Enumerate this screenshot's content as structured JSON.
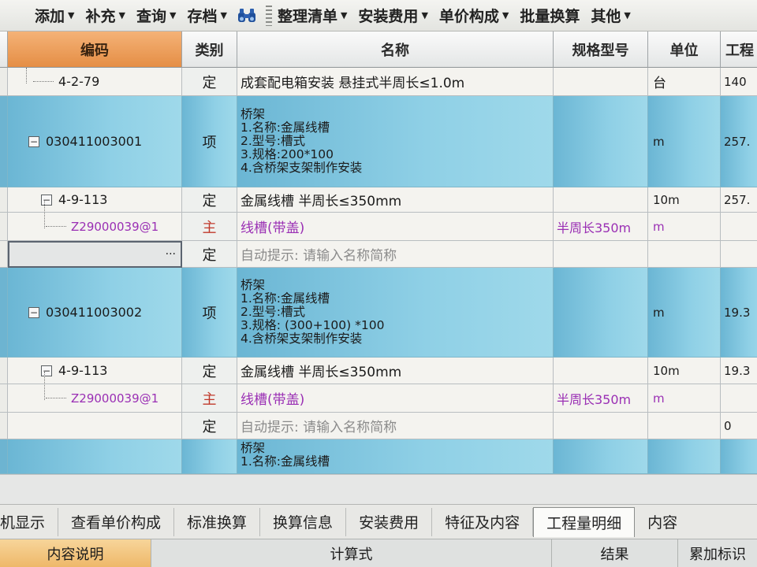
{
  "toolbar": {
    "items": [
      {
        "label": "添加",
        "dropdown": true
      },
      {
        "label": "补充",
        "dropdown": true
      },
      {
        "label": "查询",
        "dropdown": true
      },
      {
        "label": "存档",
        "dropdown": true
      },
      {
        "label": "整理清单",
        "dropdown": true
      },
      {
        "label": "安装费用",
        "dropdown": true
      },
      {
        "label": "单价构成",
        "dropdown": true
      },
      {
        "label": "批量换算",
        "dropdown": false
      },
      {
        "label": "其他",
        "dropdown": true
      }
    ],
    "search_icon": "binoculars-icon"
  },
  "grid": {
    "headers": {
      "code": "编码",
      "category": "类别",
      "name": "名称",
      "spec": "规格型号",
      "unit": "单位",
      "quantity": "工程"
    },
    "rows": [
      {
        "code": "4-2-79",
        "category": "定",
        "name": "成套配电箱安装 悬挂式半周长≤1.0m",
        "spec": "",
        "unit": "台",
        "quantity": "140"
      },
      {
        "code": "030411003001",
        "category": "项",
        "name_lines": [
          "桥架",
          "1.名称:金属线槽",
          "2.型号:槽式",
          "3.规格:200*100",
          "4.含桥架支架制作安装"
        ],
        "spec": "",
        "unit": "m",
        "quantity": "257."
      },
      {
        "code": "4-9-113",
        "category": "定",
        "name": "金属线槽 半周长≤350mm",
        "spec": "",
        "unit": "10m",
        "quantity": "257."
      },
      {
        "code": "Z29000039@1",
        "category": "主",
        "name": "线槽(带盖)",
        "spec": "半周长350m",
        "unit": "m",
        "quantity": ""
      },
      {
        "code": "",
        "category": "定",
        "name": "自动提示: 请输入名称简称",
        "spec": "",
        "unit": "",
        "quantity": "",
        "edit_button": "···"
      },
      {
        "code": "030411003002",
        "category": "项",
        "name_lines": [
          "桥架",
          "1.名称:金属线槽",
          "2.型号:槽式",
          "3.规格: (300+100) *100",
          "4.含桥架支架制作安装"
        ],
        "spec": "",
        "unit": "m",
        "quantity": "19.3"
      },
      {
        "code": "4-9-113",
        "category": "定",
        "name": "金属线槽 半周长≤350mm",
        "spec": "",
        "unit": "10m",
        "quantity": "19.3"
      },
      {
        "code": "Z29000039@1",
        "category": "主",
        "name": "线槽(带盖)",
        "spec": "半周长350m",
        "unit": "m",
        "quantity": ""
      },
      {
        "code": "",
        "category": "定",
        "name": "自动提示: 请输入名称简称",
        "spec": "",
        "unit": "",
        "quantity": "0"
      },
      {
        "code": "",
        "category": "",
        "name_lines": [
          "桥架",
          "1.名称:金属线槽"
        ],
        "spec": "",
        "unit": "",
        "quantity": ""
      }
    ]
  },
  "tabs": {
    "items": [
      "机显示",
      "查看单价构成",
      "标准换算",
      "换算信息",
      "安装费用",
      "特征及内容",
      "工程量明细",
      "内容"
    ],
    "active_index": 6
  },
  "bottom": {
    "headers": [
      "内容说明",
      "计算式",
      "结果",
      "累加标识"
    ]
  },
  "colors": {
    "bill_row": "#8fd0e6",
    "selected_header": "#e58e45",
    "main_material_text": "#9a2fb4",
    "hint_text": "#8b8b8b"
  }
}
